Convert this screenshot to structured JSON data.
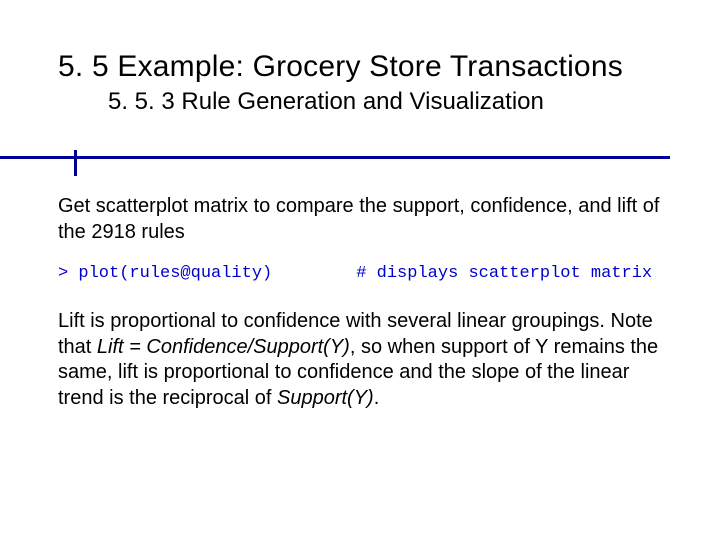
{
  "heading": {
    "title": "5. 5 Example: Grocery Store Transactions",
    "subtitle": "5. 5. 3 Rule Generation and Visualization"
  },
  "body": {
    "p1": "Get scatterplot matrix to compare the support, confidence, and lift of the 2918 rules",
    "code_prompt": "> ",
    "code_call": "plot(rules@quality)",
    "code_comment": "# displays scatterplot matrix",
    "p2a": "Lift is proportional to confidence with several linear groupings. Note that ",
    "p2_formula": "Lift = Confidence/Support(Y)",
    "p2b": ", so when support of Y remains the same, lift is proportional to confidence and the slope of the linear trend is the reciprocal of ",
    "p2_sy": "Support(Y)",
    "p2c": "."
  }
}
